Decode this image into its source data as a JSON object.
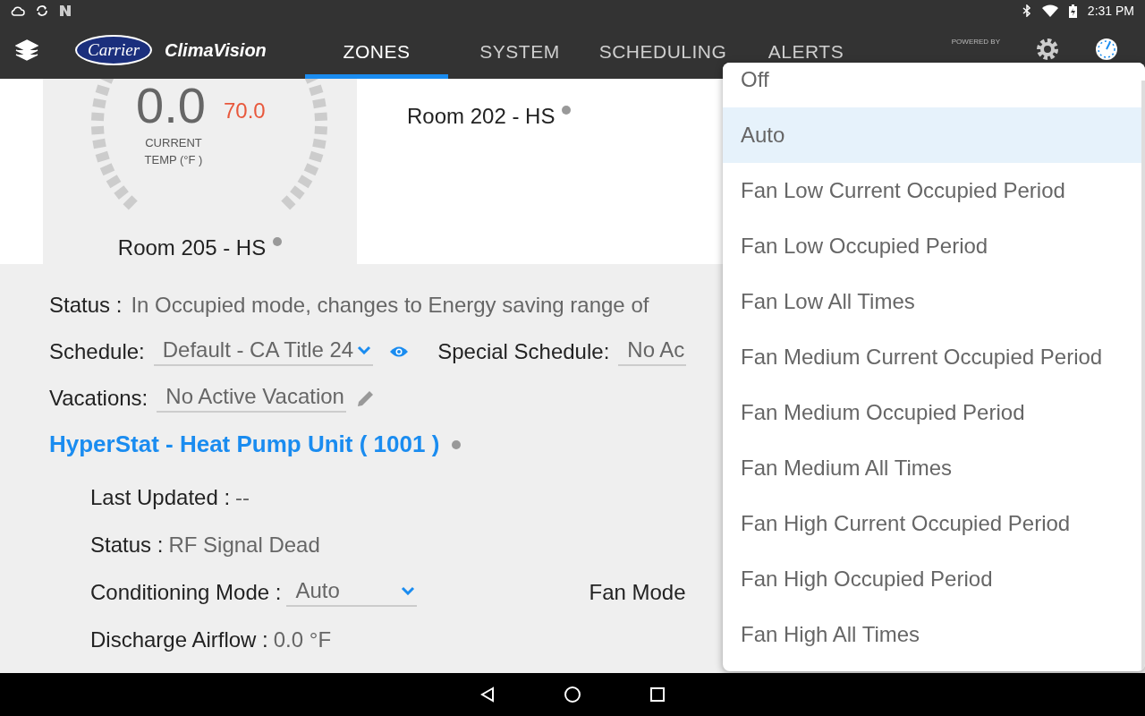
{
  "status_bar": {
    "time": "2:31 PM"
  },
  "header": {
    "logo": "Carrier",
    "app_name": "ClimaVision",
    "powered_by": "POWERED BY"
  },
  "tabs": [
    {
      "label": "ZONES",
      "selected": true
    },
    {
      "label": "SYSTEM",
      "selected": false
    },
    {
      "label": "SCHEDULING",
      "selected": false
    },
    {
      "label": "ALERTS",
      "selected": false
    }
  ],
  "zones": [
    {
      "kind": "gauge",
      "name": "Room 205 - HS",
      "current_temp": "0.0",
      "setpoint": "70.0",
      "temp_label": [
        "CURRENT",
        "TEMP (°F )"
      ]
    },
    {
      "kind": "title",
      "name": "Room 202 - HS"
    }
  ],
  "zone_details": {
    "status_label": "Status :",
    "status": "In Occupied mode, changes to Energy saving range of",
    "schedule_label": "Schedule:",
    "schedule": "Default - CA Title 24",
    "special_schedule_label": "Special Schedule:",
    "special_schedule": "No Ac",
    "vacations_label": "Vacations:",
    "vacation": "No Active Vacation"
  },
  "device": {
    "title": "HyperStat -  Heat Pump Unit ( 1001 )",
    "fields": [
      {
        "kind": "text",
        "label": "Last Updated :",
        "value": "--"
      },
      {
        "kind": "text",
        "label": "Status :",
        "value": "RF Signal Dead"
      },
      {
        "kind": "select",
        "label": "Conditioning Mode :",
        "value": "Auto",
        "side_label": "Fan Mode"
      },
      {
        "kind": "text",
        "label": "Discharge Airflow :",
        "value": "0.0 °F"
      }
    ]
  },
  "fan_mode_menu": {
    "options": [
      {
        "label": "Off",
        "selected": false
      },
      {
        "label": "Auto",
        "selected": true
      },
      {
        "label": "Fan Low Current Occupied Period",
        "selected": false
      },
      {
        "label": "Fan Low Occupied Period",
        "selected": false
      },
      {
        "label": "Fan Low All Times",
        "selected": false
      },
      {
        "label": "Fan Medium Current Occupied Period",
        "selected": false
      },
      {
        "label": "Fan Medium Occupied Period",
        "selected": false
      },
      {
        "label": "Fan Medium All Times",
        "selected": false
      },
      {
        "label": "Fan High Current Occupied Period",
        "selected": false
      },
      {
        "label": "Fan High Occupied Period",
        "selected": false
      },
      {
        "label": "Fan High All Times",
        "selected": false
      }
    ]
  }
}
